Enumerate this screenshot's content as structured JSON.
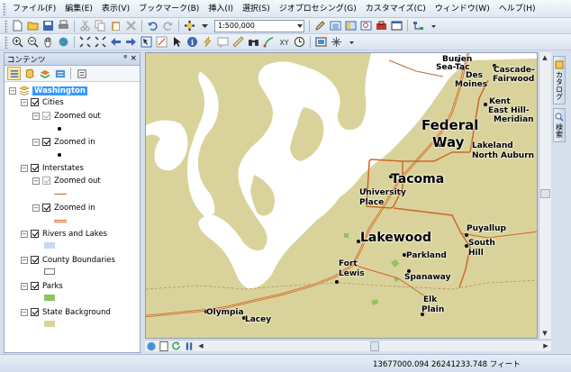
{
  "menu": [
    "ファイル(F)",
    "編集(E)",
    "表示(V)",
    "ブックマーク(B)",
    "挿入(I)",
    "選択(S)",
    "ジオプロセシング(G)",
    "カスタマイズ(C)",
    "ウィンドウ(W)",
    "ヘルプ(H)"
  ],
  "toolbar": {
    "scale_value": "1:500,000"
  },
  "toc": {
    "title": "コンテンツ",
    "pin": "ᵠ",
    "close": "×",
    "root": "Washington",
    "layers": [
      {
        "name": "Cities",
        "classes": [
          "Zoomed out",
          "Zoomed in"
        ]
      },
      {
        "name": "Interstates",
        "classes": [
          "Zoomed out",
          "Zoomed in"
        ]
      },
      {
        "name": "Rivers and Lakes"
      },
      {
        "name": "County Boundaries"
      },
      {
        "name": "Parks"
      },
      {
        "name": "State Background"
      }
    ]
  },
  "map": {
    "cities": [
      {
        "name": "Burien",
        "size": "small"
      },
      {
        "name": "Sea-Tac",
        "size": "small"
      },
      {
        "name": "Des",
        "size": "small"
      },
      {
        "name": "Moines",
        "size": "small"
      },
      {
        "name": "Cascade-",
        "size": "small"
      },
      {
        "name": "Fairwood",
        "size": "small"
      },
      {
        "name": "Kent",
        "size": "small"
      },
      {
        "name": "East Hill-",
        "size": "small"
      },
      {
        "name": "Meridian",
        "size": "small"
      },
      {
        "name": "Federal",
        "size": "large"
      },
      {
        "name": "Way",
        "size": "large"
      },
      {
        "name": "Lakeland",
        "size": "small"
      },
      {
        "name": "North Auburn",
        "size": "small"
      },
      {
        "name": "Tacoma",
        "size": "large"
      },
      {
        "name": "University",
        "size": "small"
      },
      {
        "name": "Place",
        "size": "small"
      },
      {
        "name": "Lakewood",
        "size": "large"
      },
      {
        "name": "Puyallup",
        "size": "small"
      },
      {
        "name": "South",
        "size": "small"
      },
      {
        "name": "Hill",
        "size": "small"
      },
      {
        "name": "Parkland",
        "size": "small"
      },
      {
        "name": "Fort",
        "size": "small"
      },
      {
        "name": "Lewis",
        "size": "small"
      },
      {
        "name": "Spanaway",
        "size": "small"
      },
      {
        "name": "Elk",
        "size": "small"
      },
      {
        "name": "Plain",
        "size": "small"
      },
      {
        "name": "Olympia",
        "size": "small"
      },
      {
        "name": "Lacey",
        "size": "small"
      }
    ],
    "colors": {
      "land": "#d9d39b",
      "water": "#ffffff",
      "interstate": "#c96a2a",
      "park": "#8fc461"
    }
  },
  "side_tabs": [
    "カタログ",
    "検索"
  ],
  "status": {
    "coordinates": "13677000.094  26241233.748 フィート"
  }
}
